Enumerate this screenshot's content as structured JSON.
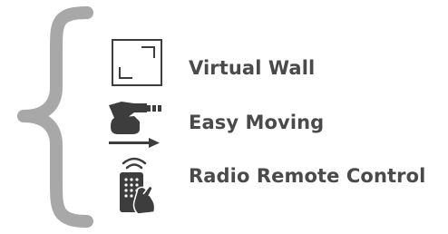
{
  "colors": {
    "brace": "#a8a8a8",
    "icon": "#3d3d3d",
    "label": "#4a4a4a"
  },
  "features": [
    {
      "icon": "virtual-wall-icon",
      "label": "Virtual Wall"
    },
    {
      "icon": "easy-moving-icon",
      "label": "Easy Moving"
    },
    {
      "icon": "radio-remote-control-icon",
      "label": "Radio Remote Control"
    }
  ]
}
